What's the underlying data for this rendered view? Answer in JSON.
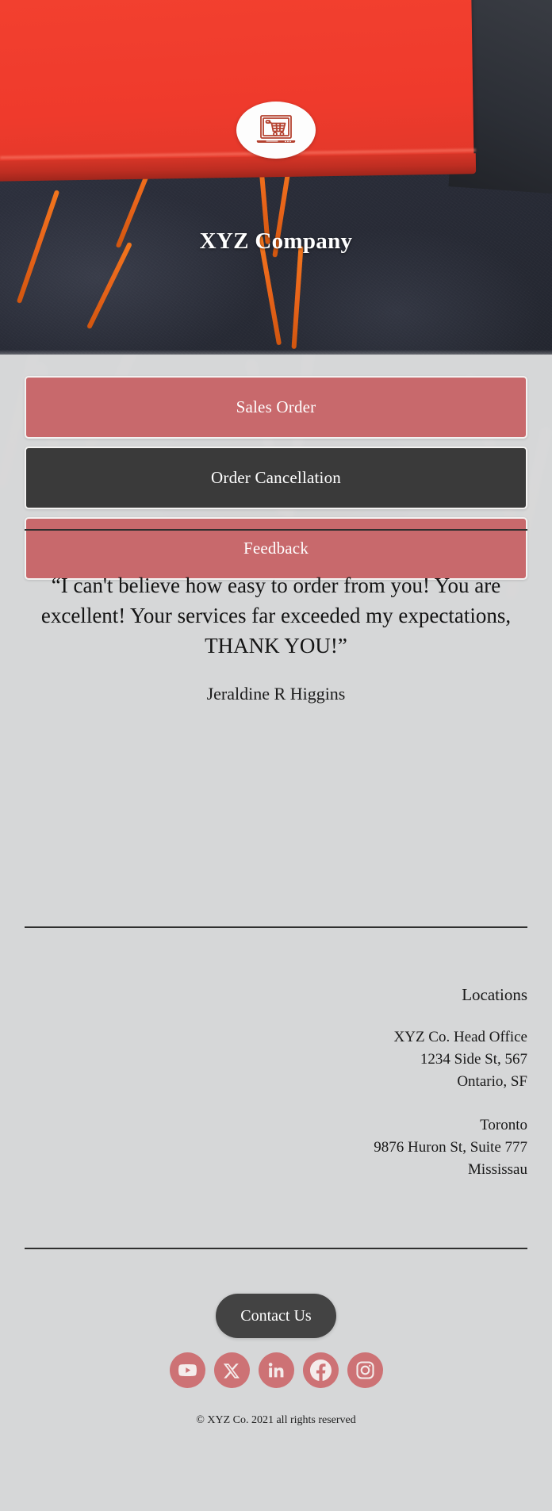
{
  "hero": {
    "logo_icon": "laptop-shopping-cart-icon",
    "company_name": "XYZ Company"
  },
  "actions": [
    {
      "label": "Sales Order",
      "style": "rose",
      "name": "sales-order-button"
    },
    {
      "label": "Order Cancellation",
      "style": "dark",
      "name": "order-cancellation-button"
    },
    {
      "label": "Feedback",
      "style": "rose",
      "name": "feedback-button"
    }
  ],
  "testimonial": {
    "quote": "“I can't believe how easy to order from you! You are excellent! Your services far exceeded my expectations, THANK YOU!”",
    "author": "Jeraldine R Higgins"
  },
  "locations": {
    "heading": "Locations",
    "entries": [
      {
        "name": "XYZ Co. Head Office",
        "street": "1234 Side St,  567",
        "city": "Ontario, SF"
      },
      {
        "name": "Toronto",
        "street": "9876 Huron St, Suite 777",
        "city": "Mississau"
      }
    ]
  },
  "footer": {
    "contact_label": "Contact Us",
    "socials": [
      {
        "name": "youtube-icon",
        "label": "YouTube"
      },
      {
        "name": "x-twitter-icon",
        "label": "X"
      },
      {
        "name": "linkedin-icon",
        "label": "LinkedIn"
      },
      {
        "name": "facebook-icon",
        "label": "Facebook"
      },
      {
        "name": "instagram-icon",
        "label": "Instagram"
      }
    ],
    "copyright": "© XYZ Co. 2021 all rights reserved"
  },
  "colors": {
    "rose": "#c8696c",
    "dark": "#3a3a3a",
    "page_bg": "#d6d7d8",
    "hero_red": "#ef3a2c",
    "social_bg": "#cd7275"
  }
}
